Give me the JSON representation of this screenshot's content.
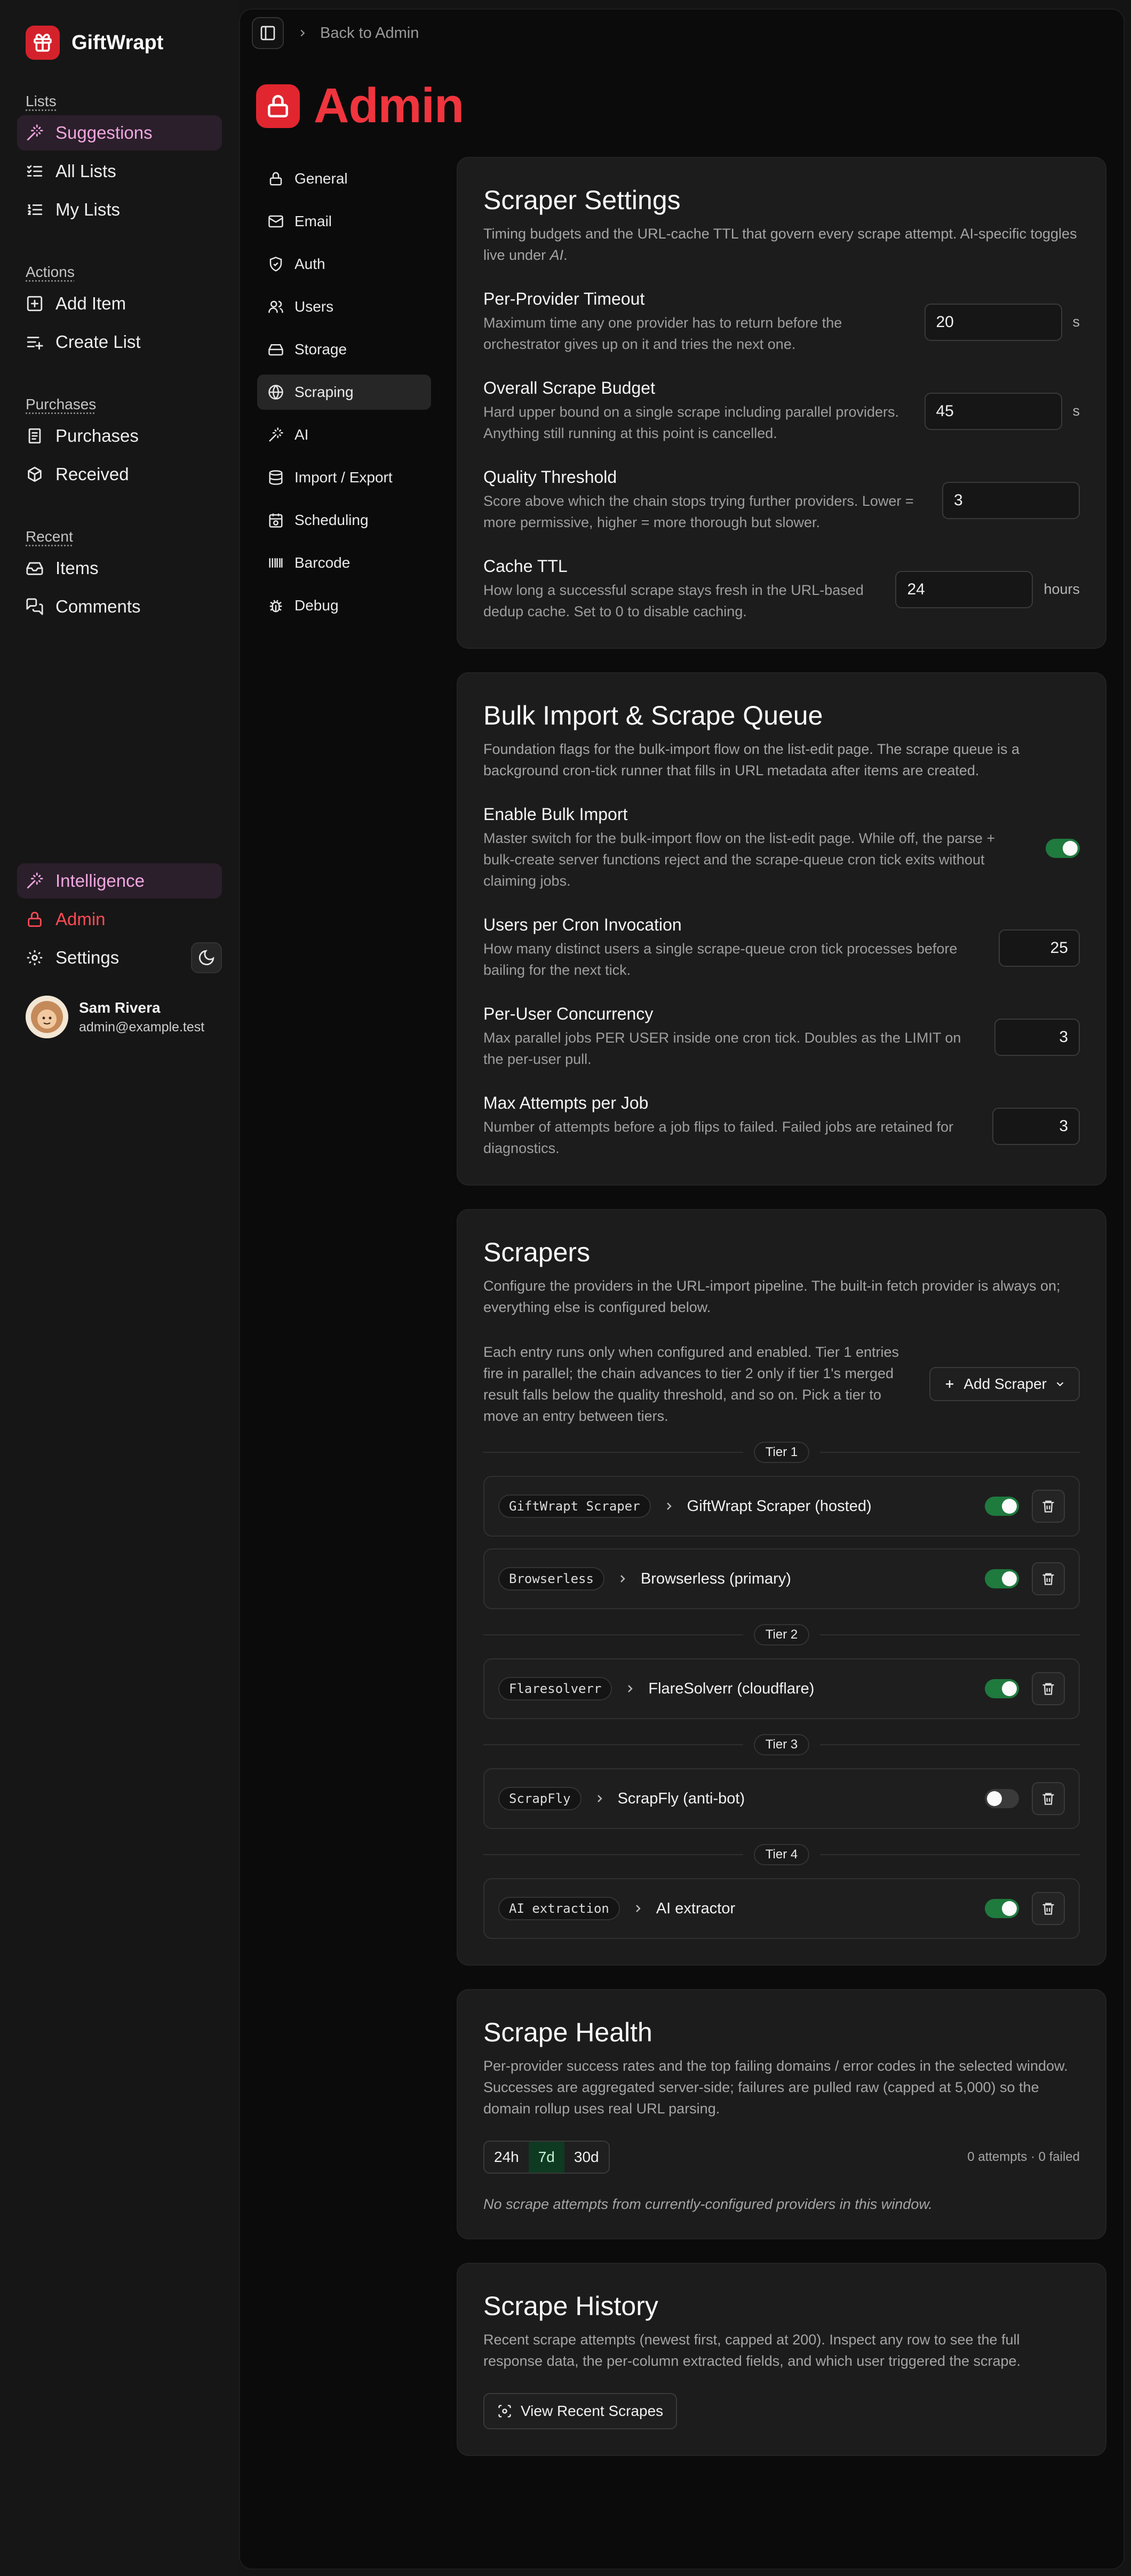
{
  "app": {
    "name": "GiftWrapt"
  },
  "sidebar": {
    "groups": [
      {
        "heading": "Lists",
        "items": [
          {
            "label": "Suggestions"
          },
          {
            "label": "All Lists"
          },
          {
            "label": "My Lists"
          }
        ]
      },
      {
        "heading": "Actions",
        "items": [
          {
            "label": "Add Item"
          },
          {
            "label": "Create List"
          }
        ]
      },
      {
        "heading": "Purchases",
        "items": [
          {
            "label": "Purchases"
          },
          {
            "label": "Received"
          }
        ]
      },
      {
        "heading": "Recent",
        "items": [
          {
            "label": "Items"
          },
          {
            "label": "Comments"
          }
        ]
      }
    ],
    "bottom": {
      "intelligence": "Intelligence",
      "admin": "Admin",
      "settings": "Settings"
    },
    "user": {
      "name": "Sam Rivera",
      "email": "admin@example.test"
    }
  },
  "header": {
    "breadcrumb": "Back to Admin",
    "title": "Admin"
  },
  "admin_nav": {
    "items": [
      {
        "label": "General"
      },
      {
        "label": "Email"
      },
      {
        "label": "Auth"
      },
      {
        "label": "Users"
      },
      {
        "label": "Storage"
      },
      {
        "label": "Scraping"
      },
      {
        "label": "AI"
      },
      {
        "label": "Import / Export"
      },
      {
        "label": "Scheduling"
      },
      {
        "label": "Barcode"
      },
      {
        "label": "Debug"
      }
    ],
    "active": "Scraping"
  },
  "scraper_settings": {
    "title": "Scraper Settings",
    "desc_main": "Timing budgets and the URL-cache TTL that govern every scrape attempt. AI-specific toggles live under ",
    "desc_em": "AI",
    "desc_end": ".",
    "fields": [
      {
        "label": "Per-Provider Timeout",
        "desc": "Maximum time any one provider has to return before the orchestrator gives up on it and tries the next one.",
        "value": "20",
        "unit": "s"
      },
      {
        "label": "Overall Scrape Budget",
        "desc": "Hard upper bound on a single scrape including parallel providers. Anything still running at this point is cancelled.",
        "value": "45",
        "unit": "s"
      },
      {
        "label": "Quality Threshold",
        "desc": "Score above which the chain stops trying further providers. Lower = more permissive, higher = more thorough but slower.",
        "value": "3",
        "unit": ""
      },
      {
        "label": "Cache TTL",
        "desc": "How long a successful scrape stays fresh in the URL-based dedup cache. Set to 0 to disable caching.",
        "value": "24",
        "unit": "hours"
      }
    ]
  },
  "bulk_import": {
    "title": "Bulk Import & Scrape Queue",
    "desc": "Foundation flags for the bulk-import flow on the list-edit page. The scrape queue is a background cron-tick runner that fills in URL metadata after items are created.",
    "enable": {
      "label": "Enable Bulk Import",
      "desc": "Master switch for the bulk-import flow on the list-edit page. While off, the parse + bulk-create server functions reject and the scrape-queue cron tick exits without claiming jobs.",
      "enabled": true
    },
    "fields": [
      {
        "label": "Users per Cron Invocation",
        "desc": "How many distinct users a single scrape-queue cron tick processes before bailing for the next tick.",
        "value": "25"
      },
      {
        "label": "Per-User Concurrency",
        "desc": "Max parallel jobs PER USER inside one cron tick. Doubles as the LIMIT on the per-user pull.",
        "value": "3"
      },
      {
        "label": "Max Attempts per Job",
        "desc": "Number of attempts before a job flips to failed. Failed jobs are retained for diagnostics.",
        "value": "3"
      }
    ]
  },
  "scrapers": {
    "title": "Scrapers",
    "desc": "Configure the providers in the URL-import pipeline. The built-in fetch provider is always on; everything else is configured below.",
    "tier_desc": "Each entry runs only when configured and enabled. Tier 1 entries fire in parallel; the chain advances to tier 2 only if tier 1's merged result falls below the quality threshold, and so on. Pick a tier to move an entry between tiers.",
    "add_label": "Add Scraper",
    "tiers": [
      {
        "label": "Tier 1",
        "entries": [
          {
            "code": "GiftWrapt Scraper",
            "name": "GiftWrapt Scraper (hosted)",
            "enabled": true
          },
          {
            "code": "Browserless",
            "name": "Browserless (primary)",
            "enabled": true
          }
        ]
      },
      {
        "label": "Tier 2",
        "entries": [
          {
            "code": "Flaresolverr",
            "name": "FlareSolverr (cloudflare)",
            "enabled": true
          }
        ]
      },
      {
        "label": "Tier 3",
        "entries": [
          {
            "code": "ScrapFly",
            "name": "ScrapFly (anti-bot)",
            "enabled": false
          }
        ]
      },
      {
        "label": "Tier 4",
        "entries": [
          {
            "code": "AI extraction",
            "name": "AI extractor",
            "enabled": true
          }
        ]
      }
    ]
  },
  "scrape_health": {
    "title": "Scrape Health",
    "desc": "Per-provider success rates and the top failing domains / error codes in the selected window. Successes are aggregated server-side; failures are pulled raw (capped at 5,000) so the domain rollup uses real URL parsing.",
    "ranges": [
      "24h",
      "7d",
      "30d"
    ],
    "selected_range": "7d",
    "stats": "0 attempts · 0 failed",
    "empty": "No scrape attempts from currently-configured providers in this window."
  },
  "scrape_history": {
    "title": "Scrape History",
    "desc": "Recent scrape attempts (newest first, capped at 200). Inspect any row to see the full response data, the per-column extracted fields, and which user triggered the scrape.",
    "button": "View Recent Scrapes"
  },
  "colors": {
    "accent_red": "#e12630",
    "pink": "#f0a6df",
    "toggle_on": "#1f7a3e"
  }
}
